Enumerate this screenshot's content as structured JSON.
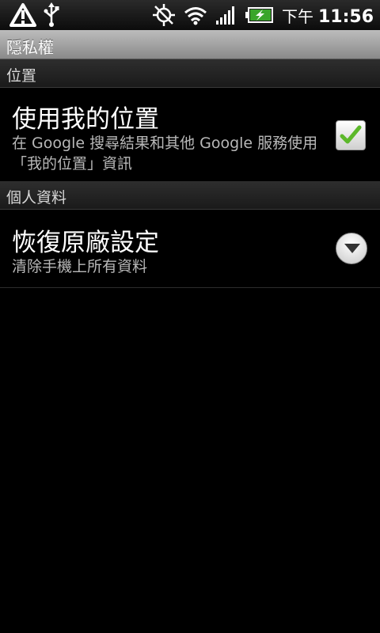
{
  "status_bar": {
    "ampm": "下午",
    "time": "11:56",
    "icons": [
      "warning-icon",
      "usb-icon",
      "gps-off-icon",
      "wifi-icon",
      "signal-icon",
      "battery-charging-icon"
    ]
  },
  "title_bar": {
    "title": "隱私權"
  },
  "sections": [
    {
      "header": "位置",
      "item": {
        "title": "使用我的位置",
        "summary": "在 Google 搜尋結果和其他 Google 服務使用「我的位置」資訊",
        "control": "checkbox",
        "checked": true
      }
    },
    {
      "header": "個人資料",
      "item": {
        "title": "恢復原廠設定",
        "summary": "清除手機上所有資料",
        "control": "dropdown-arrow"
      }
    }
  ],
  "colors": {
    "background": "#000000",
    "title_bar": "#a8a8a8",
    "check_green": "#5cb82a",
    "summary_text": "#b8b8b8"
  }
}
